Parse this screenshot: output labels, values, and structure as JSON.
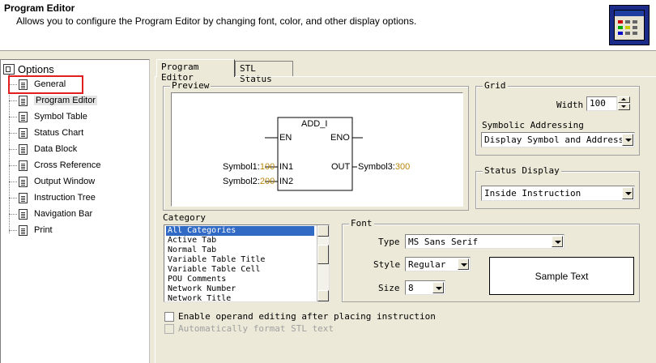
{
  "header": {
    "title": "Program Editor",
    "description": "Allows you to configure the Program Editor by changing font, color, and other display options.",
    "icon": "program-editor-icon"
  },
  "tree": {
    "root_label": "Options",
    "items": [
      {
        "label": "General",
        "icon": "document-icon"
      },
      {
        "label": "Program Editor",
        "icon": "document-icon"
      },
      {
        "label": "Symbol Table",
        "icon": "document-icon"
      },
      {
        "label": "Status Chart",
        "icon": "document-icon"
      },
      {
        "label": "Data Block",
        "icon": "document-icon"
      },
      {
        "label": "Cross Reference",
        "icon": "document-icon"
      },
      {
        "label": "Output Window",
        "icon": "document-icon"
      },
      {
        "label": "Instruction Tree",
        "icon": "document-icon"
      },
      {
        "label": "Navigation Bar",
        "icon": "document-icon"
      },
      {
        "label": "Print",
        "icon": "document-icon"
      }
    ],
    "highlight_color": "#e02020"
  },
  "tabs": [
    {
      "label": "Program Editor",
      "active": true
    },
    {
      "label": "STL Status",
      "active": false
    }
  ],
  "preview": {
    "legend": "Preview",
    "block_title": "ADD_I",
    "pin_en": "EN",
    "pin_eno": "ENO",
    "pin_in1": "IN1",
    "pin_in2": "IN2",
    "pin_out": "OUT",
    "sym1_name": "Symbol1:",
    "sym1_value": "100",
    "sym2_name": "Symbol2:",
    "sym2_value": "200",
    "sym3_name": "Symbol3:",
    "sym3_value": "300",
    "value_color": "#b8860b"
  },
  "grid": {
    "legend": "Grid",
    "width_label": "Width",
    "width_value": "100",
    "symbolic_label": "Symbolic Addressing",
    "symbolic_value": "Display Symbol and Address"
  },
  "status_display": {
    "legend": "Status Display",
    "value": "Inside Instruction"
  },
  "category": {
    "label": "Category",
    "items": [
      "All Categories",
      "Active Tab",
      "Normal Tab",
      "Variable Table Title",
      "Variable Table Cell",
      "POU Comments",
      "Network Number",
      "Network Title"
    ],
    "selected_index": 0,
    "selected_color": "#316ac5"
  },
  "font": {
    "legend": "Font",
    "type_label": "Type",
    "type_value": "MS Sans Serif",
    "style_label": "Style",
    "style_value": "Regular",
    "size_label": "Size",
    "size_value": "8",
    "sample_text": "Sample Text"
  },
  "options": {
    "enable_operand_label": "Enable operand editing after placing instruction",
    "auto_format_label": "Automatically format STL text"
  }
}
